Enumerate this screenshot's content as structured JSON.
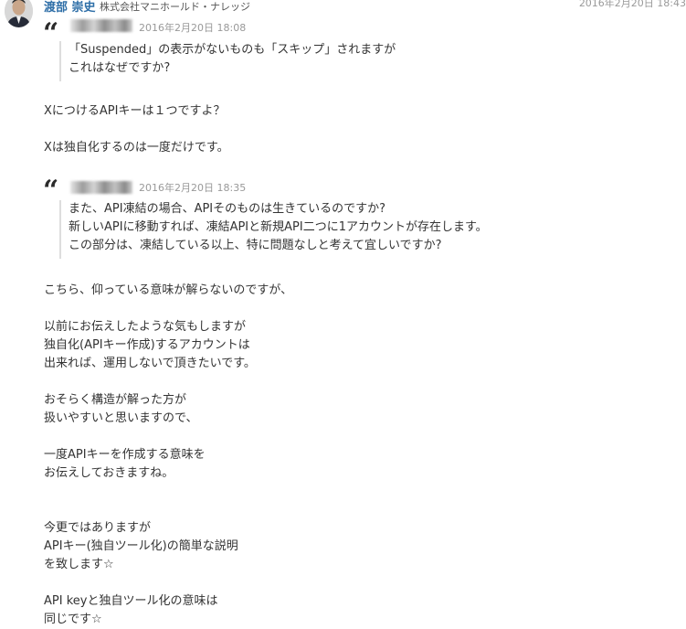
{
  "author": {
    "name": "渡部 崇史",
    "company": "株式会社マニホールド・ナレッジ"
  },
  "post_date": "2016年2月20日 18:43",
  "quotes": [
    {
      "date": "2016年2月20日 18:08",
      "lines": [
        "「Suspended」の表示がないものも「スキップ」されますが",
        "これはなぜですか?"
      ]
    },
    {
      "date": "2016年2月20日 18:35",
      "lines": [
        "また、API凍結の場合、APIそのものは生きているのですか?",
        "新しいAPIに移動すれば、凍結APIと新規API二つに1アカウントが存在します。",
        "この部分は、凍結している以上、特に問題なしと考えて宜しいですか?"
      ]
    }
  ],
  "reply_blocks": [
    [
      "XにつけるAPIキーは１つですよ？",
      "",
      "Xは独自化するのは一度だけです。"
    ],
    [
      "こちら、仰っている意味が解らないのですが、",
      "",
      "以前にお伝えしたような気もしますが",
      "独自化(APIキー作成)するアカウントは",
      "出来れば、運用しないで頂きたいです。",
      "",
      "おそらく構造が解った方が",
      "扱いやすいと思いますので、",
      "",
      "一度APIキーを作成する意味を",
      "お伝えしておきますね。",
      "",
      "",
      "今更ではありますが",
      "APIキー(独自ツール化)の簡単な説明",
      "を致します☆",
      "",
      "API keyと独自ツール化の意味は",
      "同じです☆"
    ]
  ]
}
